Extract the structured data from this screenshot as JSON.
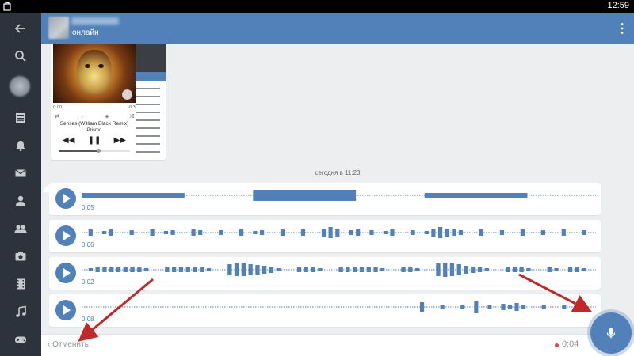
{
  "status_bar": {
    "time": "12:59"
  },
  "sidebar": {
    "items": [
      {
        "icon": "back-arrow-icon"
      },
      {
        "icon": "search-icon"
      },
      {
        "icon": "profile-avatar"
      },
      {
        "icon": "news-icon"
      },
      {
        "icon": "bell-icon"
      },
      {
        "icon": "mail-icon"
      },
      {
        "icon": "person-icon"
      },
      {
        "icon": "group-icon"
      },
      {
        "icon": "camera-icon"
      },
      {
        "icon": "film-icon"
      },
      {
        "icon": "music-icon"
      },
      {
        "icon": "gamepad-icon"
      }
    ]
  },
  "header": {
    "status": "онлайн",
    "menu_icon": "more-vertical-icon"
  },
  "attachment": {
    "time_left": "0:00",
    "time_right": "-0:3",
    "track_title": "Senses (William Black Remix)",
    "artist": "Prismo"
  },
  "date_separator": "сегодня в 11:23",
  "voice_messages": [
    {
      "duration": "0:05",
      "bars": [
        6,
        14,
        6
      ]
    },
    {
      "duration": "0:06",
      "bars": [
        3,
        8,
        3,
        4,
        8,
        3,
        3,
        6,
        3,
        3,
        8,
        3,
        4,
        6,
        3,
        3,
        8,
        6,
        3,
        3,
        6,
        3,
        3,
        8,
        3,
        4,
        6,
        3,
        3,
        8,
        3,
        3,
        8,
        3,
        3,
        10,
        14,
        10,
        3,
        6,
        8,
        3,
        6,
        3,
        4,
        8,
        3,
        3,
        6,
        3,
        4,
        10,
        14,
        10,
        8,
        6,
        3,
        3,
        8,
        3,
        3,
        6,
        3,
        3,
        8,
        3,
        3,
        6,
        3,
        3,
        8,
        3,
        3,
        6,
        3
      ]
    },
    {
      "duration": "0:02",
      "bars": [
        3,
        4,
        6,
        6,
        6,
        6,
        6,
        6,
        6,
        4,
        3,
        3,
        6,
        6,
        6,
        6,
        6,
        6,
        4,
        3,
        3,
        14,
        16,
        16,
        14,
        12,
        10,
        8,
        4,
        3,
        3,
        6,
        6,
        6,
        4,
        3,
        3,
        6,
        6,
        6,
        6,
        6,
        6,
        4,
        3,
        3,
        6,
        6,
        4,
        3,
        3,
        16,
        18,
        16,
        14,
        10,
        8,
        6,
        4,
        3,
        3,
        6,
        6,
        6,
        4,
        3,
        3,
        6,
        4,
        3,
        6,
        6,
        4,
        3
      ]
    },
    {
      "duration": "0:08",
      "bars": [
        3,
        3,
        3,
        3,
        3,
        3,
        3,
        3,
        3,
        3,
        3,
        3,
        3,
        3,
        3,
        3,
        3,
        3,
        3,
        3,
        3,
        3,
        3,
        3,
        3,
        3,
        3,
        3,
        3,
        3,
        3,
        3,
        3,
        3,
        3,
        3,
        3,
        3,
        3,
        3,
        3,
        3,
        3,
        3,
        3,
        3,
        3,
        3,
        3,
        3,
        12,
        3,
        3,
        4,
        3,
        3,
        6,
        3,
        16,
        3,
        4,
        3,
        8,
        6,
        10,
        4,
        3,
        3,
        6,
        3,
        3,
        4,
        3,
        3,
        3,
        3
      ]
    }
  ],
  "bottom_bar": {
    "cancel_label": "Отменить",
    "recording_time": "0:04"
  },
  "colors": {
    "accent": "#5181b8",
    "sidebar_bg": "#2d333c",
    "recording_dot": "#e64646",
    "annotation_arrow": "#c0282a"
  }
}
